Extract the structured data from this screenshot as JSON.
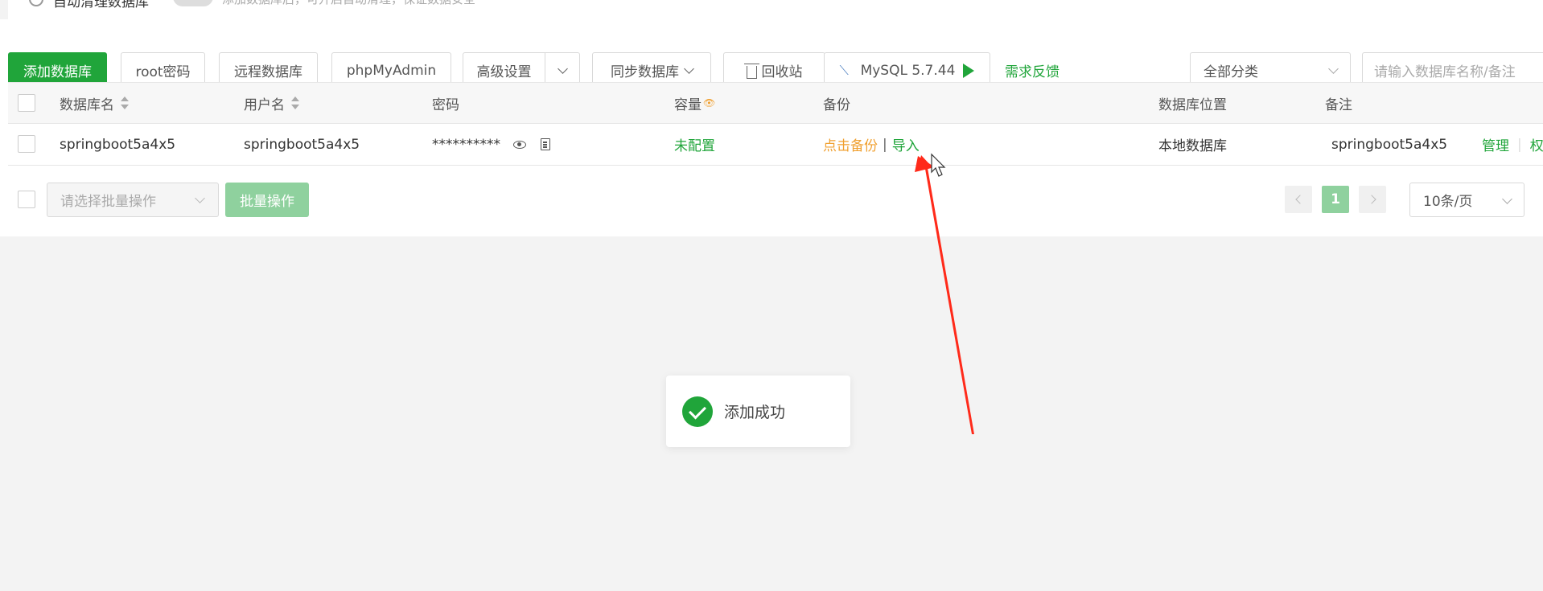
{
  "top_strip": {
    "label": "自动清理数据库",
    "hint": "添加数据库后，可开启自动清理，保证数据安全"
  },
  "toolbar": {
    "add_db": "添加数据库",
    "root_pwd": "root密码",
    "remote_db": "远程数据库",
    "phpmyadmin": "phpMyAdmin",
    "advanced": "高级设置",
    "sync_db": "同步数据库",
    "recycle": "回收站",
    "mysql_version": "MySQL 5.7.44",
    "feedback": "需求反馈",
    "category": "全部分类",
    "search_placeholder": "请输入数据库名称/备注"
  },
  "table": {
    "headers": {
      "db_name": "数据库名",
      "username": "用户名",
      "password": "密码",
      "capacity": "容量",
      "backup": "备份",
      "location": "数据库位置",
      "remark": "备注"
    },
    "rows": [
      {
        "db_name": "springboot5a4x5",
        "username": "springboot5a4x5",
        "password": "**********",
        "capacity": "未配置",
        "backup_action": "点击备份",
        "import_action": "导入",
        "location": "本地数据库",
        "remark": "springboot5a4x5",
        "manage": "管理",
        "perm": "权"
      }
    ]
  },
  "footer": {
    "bulk_placeholder": "请选择批量操作",
    "bulk_button": "批量操作",
    "current_page": "1",
    "page_size": "10条/页"
  },
  "toast": {
    "message": "添加成功"
  },
  "colors": {
    "primary": "#20a53a",
    "warning": "#f0a030",
    "annotation": "#ff2a1a"
  }
}
